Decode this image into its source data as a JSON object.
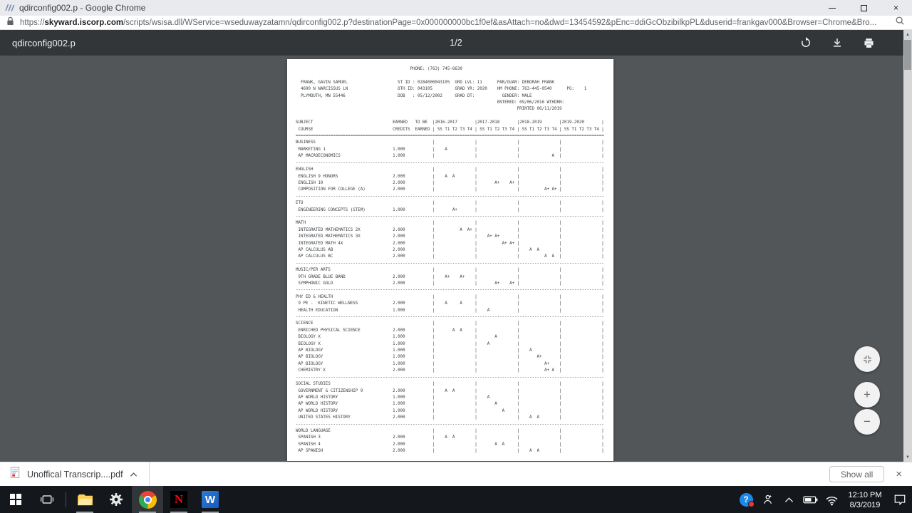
{
  "window": {
    "title": "qdirconfig002.p - Google Chrome",
    "close_glyph": "×"
  },
  "urlbar": {
    "protocol": "https://",
    "domain": "skyward.iscorp.com",
    "path": "/scripts/wsisa.dll/WService=wseduwayzatamn/qdirconfig002.p?destinationPage=0x000000000bc1f0ef&asAttach=no&dwd=13454592&pEnc=ddiGcObzibilkpPL&duserid=frankgav000&Browser=Chrome&Bro..."
  },
  "pdf_toolbar": {
    "title": "qdirconfig002.p",
    "page_indicator": "1/2"
  },
  "viewer": {
    "zoom_in": "+",
    "zoom_out": "−",
    "scroll_up": "▲",
    "scroll_down": "▼"
  },
  "document": {
    "header_lines": [
      [
        46,
        "PHONE: (763) 745-6630"
      ],
      [
        0,
        ""
      ],
      [
        0,
        "  FRANK, GAVIN SAMUEL                    ST ID : 0284000043105  GRD LVL: 11      PAR/GUAR: DEBORAH FRANK"
      ],
      [
        0,
        "  4690 N NARCISSUS LN                    OTH ID: 043105         GRAD YR: 2020    HM PHONE: 763-445-0540      PG:    1"
      ],
      [
        0,
        "  PLYMOUTH, MN 55446                     DOB   : 05/12/2002     GRAD DT:           GENDER: MALE"
      ],
      [
        81,
        "ENTERED: 09/06/2016 WTHDRN:"
      ],
      [
        89,
        "PRINTED 06/11/2019"
      ],
      [
        0,
        ""
      ]
    ],
    "table": {
      "col_subject": "SUBJECT",
      "col_earned": "EARNED",
      "col_tobe": "TO BE",
      "col_course": " COURSE",
      "col_credits": "CREDITS",
      "col_earned2": "EARNED",
      "years": [
        "2016-2017",
        "2017-2018",
        "2018-2019",
        "2019-2020"
      ],
      "terms": "SS T1 T2 T3 T4",
      "sections": [
        {
          "name": "BUSINESS",
          "courses": [
            {
              "name": "MARKETING 1",
              "credits": "1.000",
              "grades": [
                "    A",
                "",
                "",
                ""
              ]
            },
            {
              "name": "AP MACROECONOMICS",
              "credits": "1.000",
              "grades": [
                "",
                "",
                "             A",
                ""
              ]
            }
          ]
        },
        {
          "name": "ENGLISH",
          "courses": [
            {
              "name": "ENGLISH 9 HONORS",
              "credits": "2.000",
              "grades": [
                "    A  A",
                "",
                "",
                ""
              ]
            },
            {
              "name": "ENGLISH 10",
              "credits": "2.000",
              "grades": [
                "",
                "       A+    A+",
                "",
                ""
              ]
            },
            {
              "name": "COMPOSITION FOR COLLEGE (A)",
              "credits": "2.000",
              "grades": [
                "",
                "",
                "          A+ A+",
                ""
              ]
            }
          ]
        },
        {
          "name": "ETO",
          "courses": [
            {
              "name": "ENGINEERING CONCEPTS (STEM)",
              "credits": "1.000",
              "grades": [
                "       A+",
                "",
                "",
                ""
              ]
            }
          ]
        },
        {
          "name": "MATH",
          "courses": [
            {
              "name": "INTEGRATED MATHEMATICS 2X",
              "credits": "2.000",
              "grades": [
                "          A  A+",
                "",
                "",
                ""
              ]
            },
            {
              "name": "INTEGRATED MATHEMATICS 3X",
              "credits": "2.000",
              "grades": [
                "",
                "    A+ A+",
                "",
                ""
              ]
            },
            {
              "name": "INTEGRATED MATH 4X",
              "credits": "2.000",
              "grades": [
                "",
                "          A+ A+",
                "",
                ""
              ]
            },
            {
              "name": "AP CALCULUS AB",
              "credits": "2.000",
              "grades": [
                "",
                "",
                "    A  A",
                ""
              ]
            },
            {
              "name": "AP CALCULUS BC",
              "credits": "2.000",
              "grades": [
                "",
                "",
                "          A  A",
                ""
              ]
            }
          ]
        },
        {
          "name": "MUSIC/PER ARTS",
          "courses": [
            {
              "name": "9TH GRADE BLUE BAND",
              "credits": "2.000",
              "grades": [
                "    A+    A+",
                "",
                "",
                ""
              ]
            },
            {
              "name": "SYMPHONIC GOLD",
              "credits": "2.000",
              "grades": [
                "",
                "       A+    A+",
                "",
                ""
              ]
            }
          ]
        },
        {
          "name": "PHY ED & HEALTH",
          "courses": [
            {
              "name": "9 PE -  KINETIC WELLNESS",
              "credits": "2.000",
              "grades": [
                "    A     A",
                "",
                "",
                ""
              ]
            },
            {
              "name": "HEALTH EDUCATION",
              "credits": "1.000",
              "grades": [
                "",
                "    A",
                "",
                ""
              ]
            }
          ]
        },
        {
          "name": "SCIENCE",
          "courses": [
            {
              "name": "ENRICHED PHYSICAL SCIENCE",
              "credits": "2.000",
              "grades": [
                "       A  A",
                "",
                "",
                ""
              ]
            },
            {
              "name": "BIOLOGY X",
              "credits": "1.000",
              "grades": [
                "",
                "       A",
                "",
                ""
              ]
            },
            {
              "name": "BIOLOGY X",
              "credits": "1.000",
              "grades": [
                "",
                "    A",
                "",
                ""
              ]
            },
            {
              "name": "AP BIOLOGY",
              "credits": "1.000",
              "grades": [
                "",
                "",
                "    A",
                ""
              ]
            },
            {
              "name": "AP BIOLOGY",
              "credits": "1.000",
              "grades": [
                "",
                "",
                "       A+",
                ""
              ]
            },
            {
              "name": "AP BIOLOGY",
              "credits": "1.000",
              "grades": [
                "",
                "",
                "          A+",
                ""
              ]
            },
            {
              "name": "CHEMISTRY X",
              "credits": "2.000",
              "grades": [
                "",
                "",
                "          A+ A",
                ""
              ]
            }
          ]
        },
        {
          "name": "SOCIAL STUDIES",
          "courses": [
            {
              "name": "GOVERNMENT & CITIZENSHIP 9",
              "credits": "2.000",
              "grades": [
                "    A  A",
                "",
                "",
                ""
              ]
            },
            {
              "name": "AP WORLD HISTORY",
              "credits": "1.000",
              "grades": [
                "",
                "    A",
                "",
                ""
              ]
            },
            {
              "name": "AP WORLD HISTORY",
              "credits": "1.000",
              "grades": [
                "",
                "       A",
                "",
                ""
              ]
            },
            {
              "name": "AP WORLD HISTORY",
              "credits": "1.000",
              "grades": [
                "",
                "          A",
                "",
                ""
              ]
            },
            {
              "name": "UNITED STATES HISTORY",
              "credits": "2.000",
              "grades": [
                "",
                "",
                "    A  A",
                ""
              ]
            }
          ]
        },
        {
          "name": "WORLD LANGUAGE",
          "courses": [
            {
              "name": "SPANISH 3",
              "credits": "2.000",
              "grades": [
                "    A  A",
                "",
                "",
                ""
              ]
            },
            {
              "name": "SPANISH 4",
              "credits": "2.000",
              "grades": [
                "",
                "       A  A",
                "",
                ""
              ]
            },
            {
              "name": "AP SPANISH",
              "credits": "2.000",
              "grades": [
                "",
                "",
                "    A  A",
                ""
              ]
            }
          ]
        }
      ]
    }
  },
  "download_bar": {
    "filename": "Unoffical Transcrip....pdf",
    "show_all_label": "Show all",
    "close_glyph": "×"
  },
  "taskbar": {
    "netflix_letter": "N",
    "word_letter": "W",
    "help_glyph": "?",
    "clock_time": "12:10 PM",
    "clock_date": "8/3/2019"
  },
  "colors": {
    "pdf_toolbar": "#323639",
    "viewer_background": "#525659",
    "taskbar": "#14171c",
    "netflix_red": "#e50914",
    "word_blue": "#185abd",
    "chrome_red": "#ea4335",
    "chrome_yellow": "#fbbc05",
    "chrome_green": "#34a853",
    "chrome_blue": "#4285f4"
  }
}
